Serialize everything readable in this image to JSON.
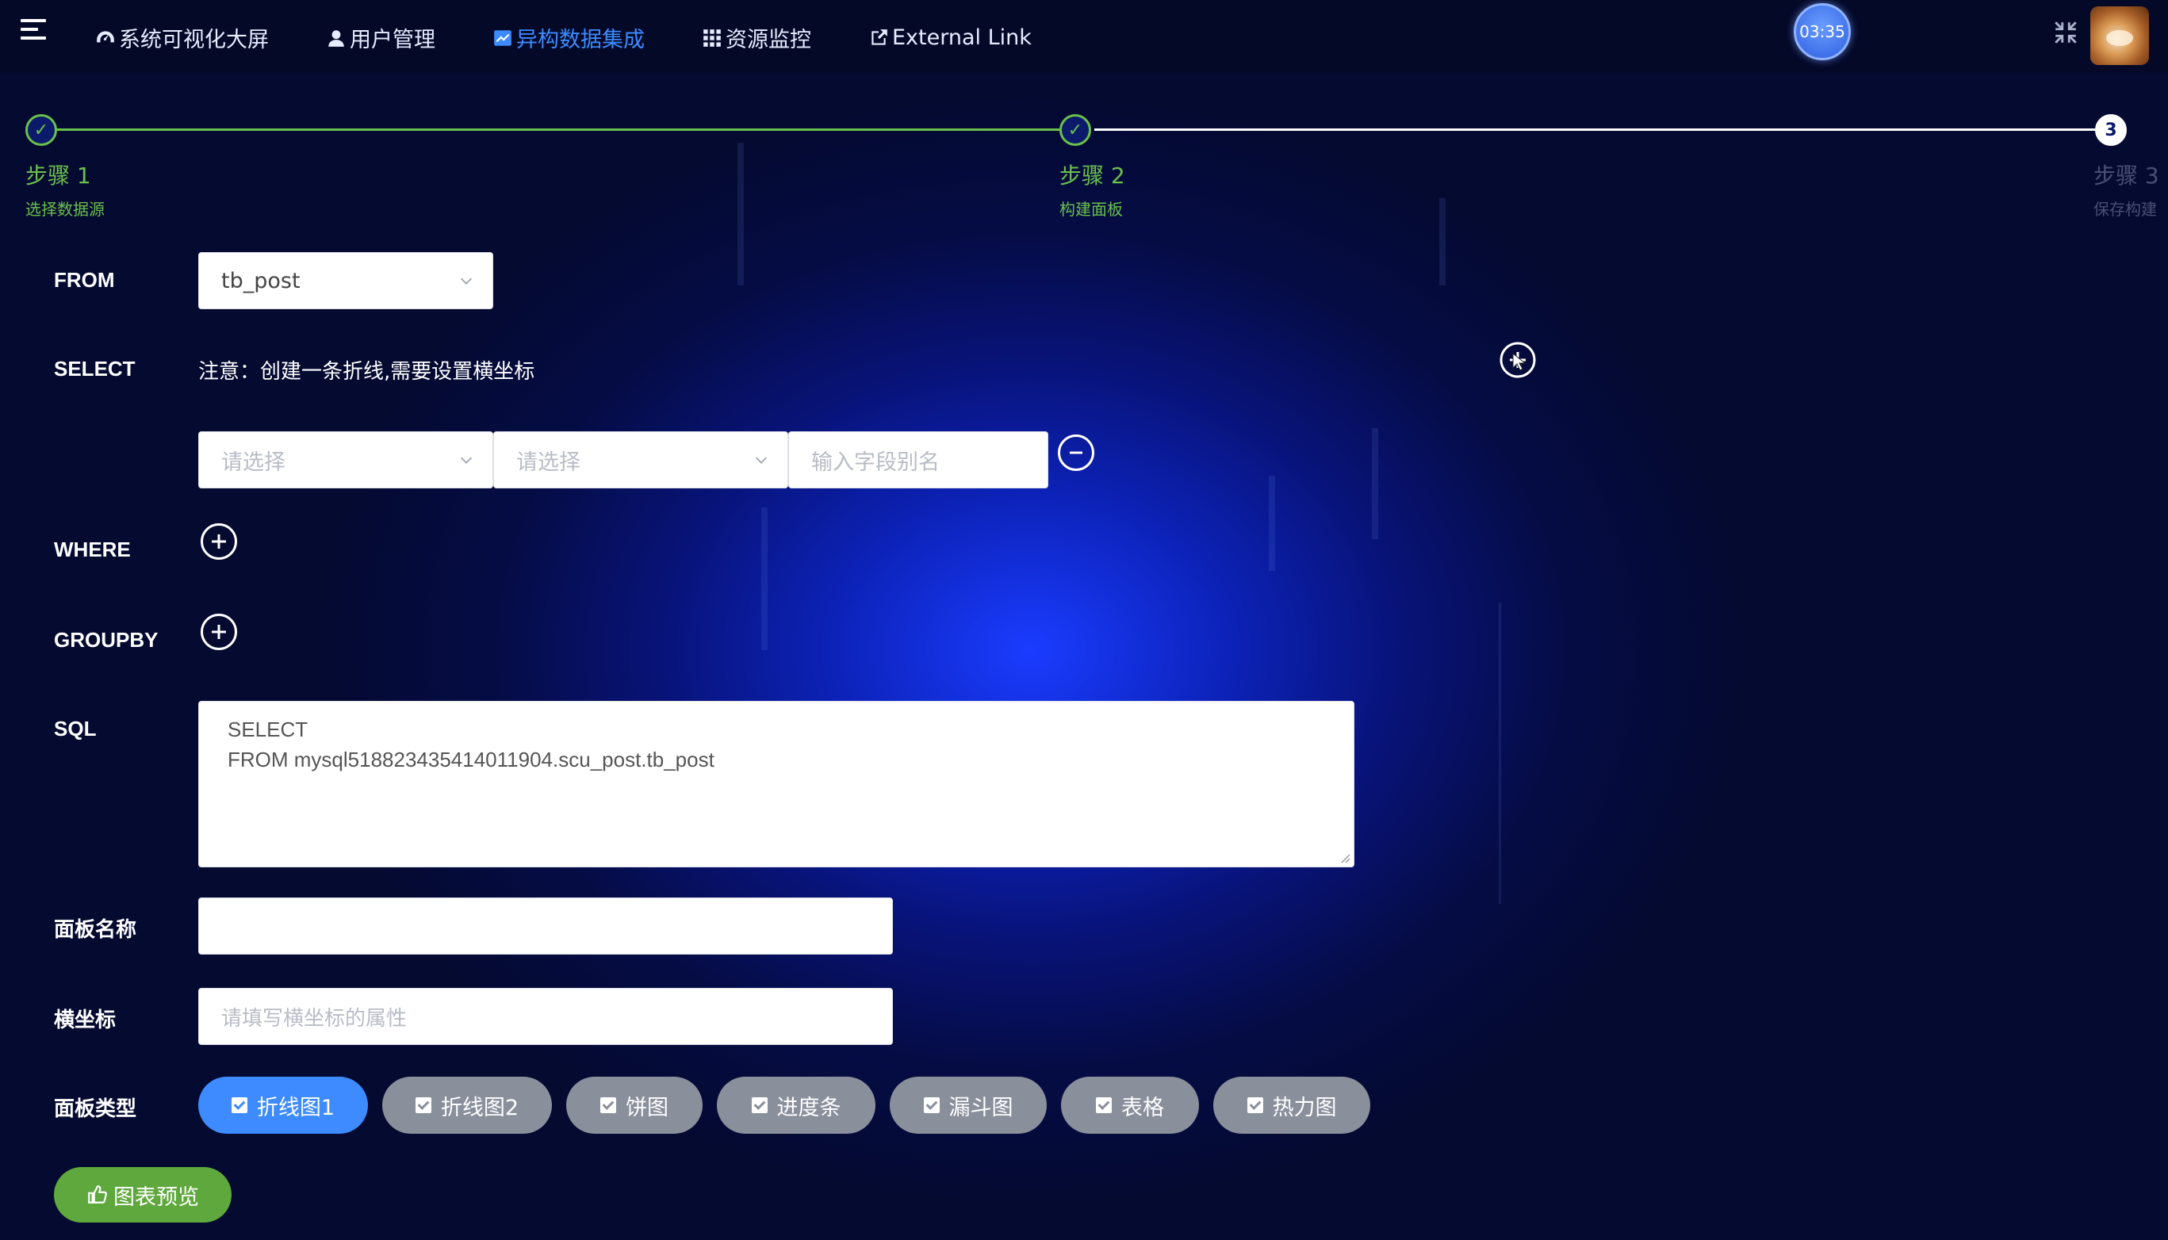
{
  "nav": {
    "items": [
      {
        "label": "系统可视化大屏",
        "icon": "dashboard-icon"
      },
      {
        "label": "用户管理",
        "icon": "user-icon"
      },
      {
        "label": "异构数据集成",
        "icon": "chart-icon",
        "active": true
      },
      {
        "label": "资源监控",
        "icon": "grid-icon"
      },
      {
        "label": "External Link",
        "icon": "external-link-icon"
      }
    ],
    "timer": "03:35"
  },
  "steps": [
    {
      "number": "1",
      "title": "步骤 1",
      "desc": "选择数据源",
      "status": "done"
    },
    {
      "number": "2",
      "title": "步骤 2",
      "desc": "构建面板",
      "status": "done"
    },
    {
      "number": "3",
      "title": "步骤 3",
      "desc": "保存构建",
      "status": "todo"
    }
  ],
  "form": {
    "from_label": "FROM",
    "from_value": "tb_post",
    "select_label": "SELECT",
    "select_note": "注意：创建一条折线,需要设置横坐标",
    "select_field_placeholder": "请选择",
    "select_func_placeholder": "请选择",
    "alias_placeholder": "输入字段别名",
    "where_label": "WHERE",
    "groupby_label": "GROUPBY",
    "sql_label": "SQL",
    "sql_line1": "SELECT",
    "sql_line2": "FROM mysql518823435414011904.scu_post.tb_post",
    "panel_name_label": "面板名称",
    "panel_name_value": "",
    "xaxis_label": "横坐标",
    "xaxis_placeholder": "请填写横坐标的属性",
    "panel_type_label": "面板类型",
    "panel_types": [
      {
        "label": "折线图1",
        "active": true
      },
      {
        "label": "折线图2",
        "active": false
      },
      {
        "label": "饼图",
        "active": false
      },
      {
        "label": "进度条",
        "active": false
      },
      {
        "label": "漏斗图",
        "active": false
      },
      {
        "label": "表格",
        "active": false
      },
      {
        "label": "热力图",
        "active": false
      }
    ],
    "preview_button": "图表预览"
  },
  "colors": {
    "accent": "#3d8bff",
    "success": "#5fa83d",
    "chip_inactive": "#8a8f9c"
  }
}
